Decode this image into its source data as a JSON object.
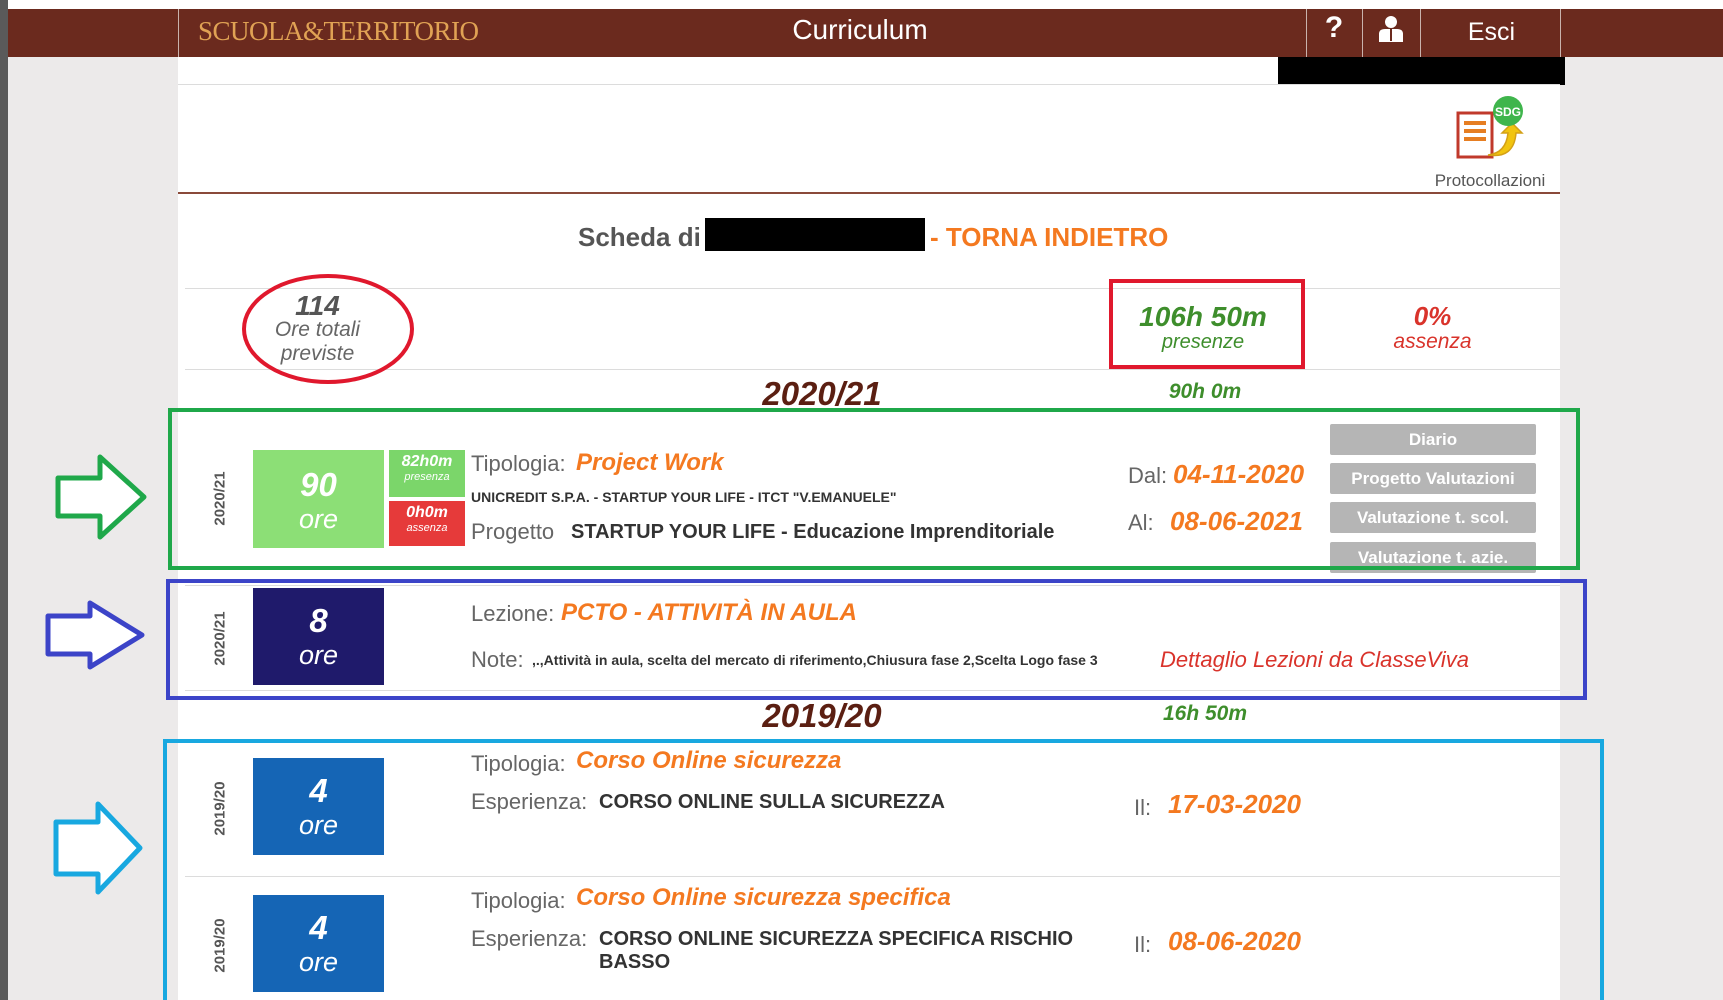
{
  "header": {
    "logo_text": "SCUOLA&TERRITORIO",
    "title": "Curriculum",
    "help_label": "?",
    "user_icon": "user-icon",
    "logout_label": "Esci"
  },
  "toolbar": {
    "protocollazioni_icon": "document-upload-icon",
    "protocollazioni_badge": "SDG",
    "protocollazioni_label": "Protocollazioni"
  },
  "page": {
    "scheda_prefix": "Scheda di",
    "back_link": "- TORNA INDIETRO"
  },
  "summary": {
    "total_hours": "114",
    "total_hours_label_1": "Ore totali",
    "total_hours_label_2": "previste",
    "presenze_value": "106h 50m",
    "presenze_label": "presenze",
    "assenza_value": "0%",
    "assenza_label": "assenza"
  },
  "years": [
    {
      "year": "2020/21",
      "hours": "90h 0m",
      "entries": [
        {
          "year_tag": "2020/21",
          "hours": "90",
          "unit": "ore",
          "presenza_value": "82h0m",
          "presenza_label": "presenza",
          "assenza_value": "0h0m",
          "assenza_label": "assenza",
          "tipologia_label": "Tipologia:",
          "tipologia_value": "Project Work",
          "company": "UNICREDIT S.P.A. - STARTUP YOUR LIFE - ITCT \"V.EMANUELE\"",
          "progetto_label": "Progetto",
          "progetto_value": "STARTUP YOUR LIFE - Educazione Imprenditoriale",
          "dal_label": "Dal:",
          "dal_value": "04-11-2020",
          "al_label": "Al:",
          "al_value": "08-06-2021",
          "buttons": [
            "Diario",
            "Progetto Valutazioni",
            "Valutazione t. scol.",
            "Valutazione t. azie."
          ]
        },
        {
          "year_tag": "2020/21",
          "hours": "8",
          "unit": "ore",
          "lezione_label": "Lezione:",
          "lezione_value": "PCTO - ATTIVITÀ IN AULA",
          "note_label": "Note:",
          "note_value": ",.,Attività in aula, scelta del mercato di riferimento,Chiusura fase 2,Scelta Logo fase 3",
          "detail_link": "Dettaglio Lezioni da ClasseViva"
        }
      ]
    },
    {
      "year": "2019/20",
      "hours": "16h 50m",
      "entries": [
        {
          "year_tag": "2019/20",
          "hours": "4",
          "unit": "ore",
          "tipologia_label": "Tipologia:",
          "tipologia_value": "Corso Online sicurezza",
          "esperienza_label": "Esperienza:",
          "esperienza_value": "CORSO ONLINE SULLA SICUREZZA",
          "il_label": "Il:",
          "il_value": "17-03-2020"
        },
        {
          "year_tag": "2019/20",
          "hours": "4",
          "unit": "ore",
          "tipologia_label": "Tipologia:",
          "tipologia_value": "Corso Online sicurezza specifica",
          "esperienza_label": "Esperienza:",
          "esperienza_value_1": "CORSO ONLINE SICUREZZA SPECIFICA RISCHIO",
          "esperienza_value_2": "BASSO",
          "il_label": "Il:",
          "il_value": "08-06-2020"
        }
      ]
    }
  ],
  "annotations": {
    "circle_color": "#e0182d",
    "presenze_box_color": "#e0182d",
    "green_color": "#1fa84a",
    "navy_color": "#3c44c8",
    "cyan_color": "#18a8e0"
  }
}
